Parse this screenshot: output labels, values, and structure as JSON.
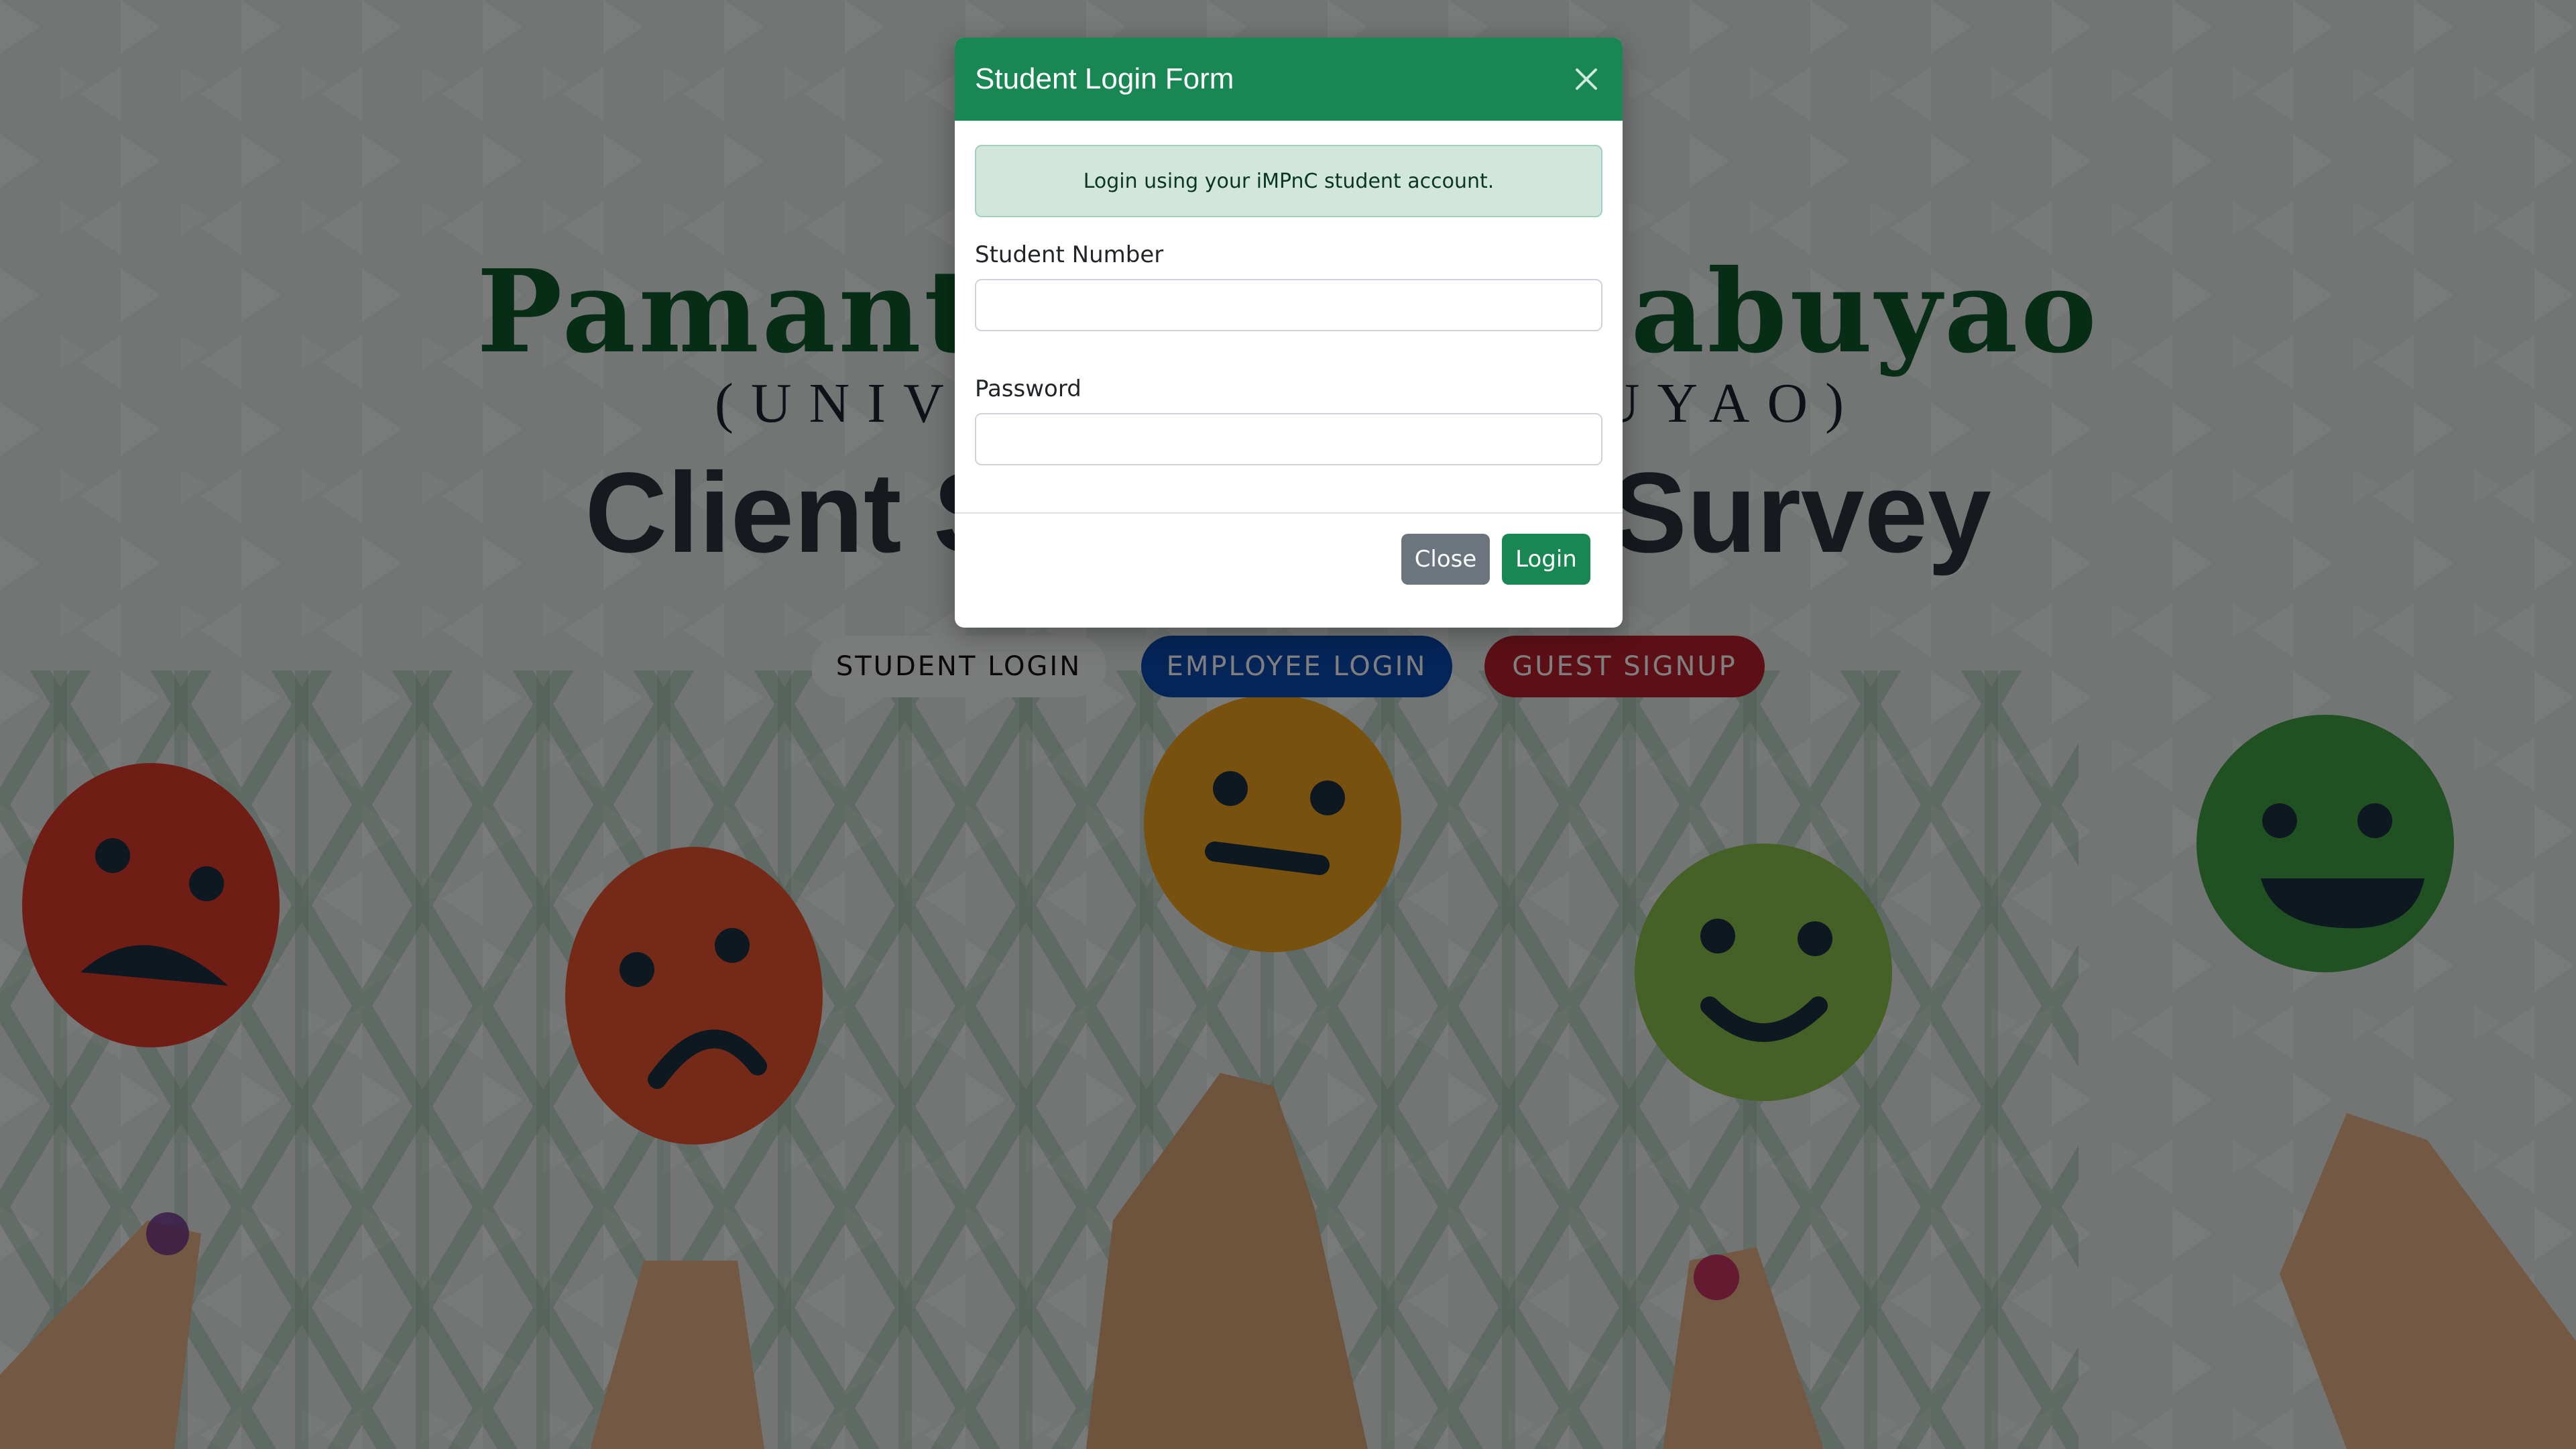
{
  "colors": {
    "brand_green": "#198754",
    "employee_blue": "#0a48b0",
    "guest_red": "#b9202b",
    "alert_bg": "#d1e7dd",
    "close_gray": "#6c757d"
  },
  "hero": {
    "university_name": "Pamantasan ng Cabuyao",
    "university_sub": "(UNIVERSITY OF CABUYAO)",
    "survey_title": "Client Satisfaction Survey",
    "buttons": {
      "student": "STUDENT LOGIN",
      "employee": "EMPLOYEE LOGIN",
      "guest": "GUEST SIGNUP"
    },
    "emoji_icons": [
      "angry-face-icon",
      "sad-face-icon",
      "neutral-face-icon",
      "smile-face-icon",
      "happy-face-icon"
    ]
  },
  "modal": {
    "title": "Student Login Form",
    "alert": "Login using your iMPnC student account.",
    "student_number_label": "Student Number",
    "student_number_value": "",
    "password_label": "Password",
    "password_value": "",
    "close_label": "Close",
    "login_label": "Login"
  }
}
